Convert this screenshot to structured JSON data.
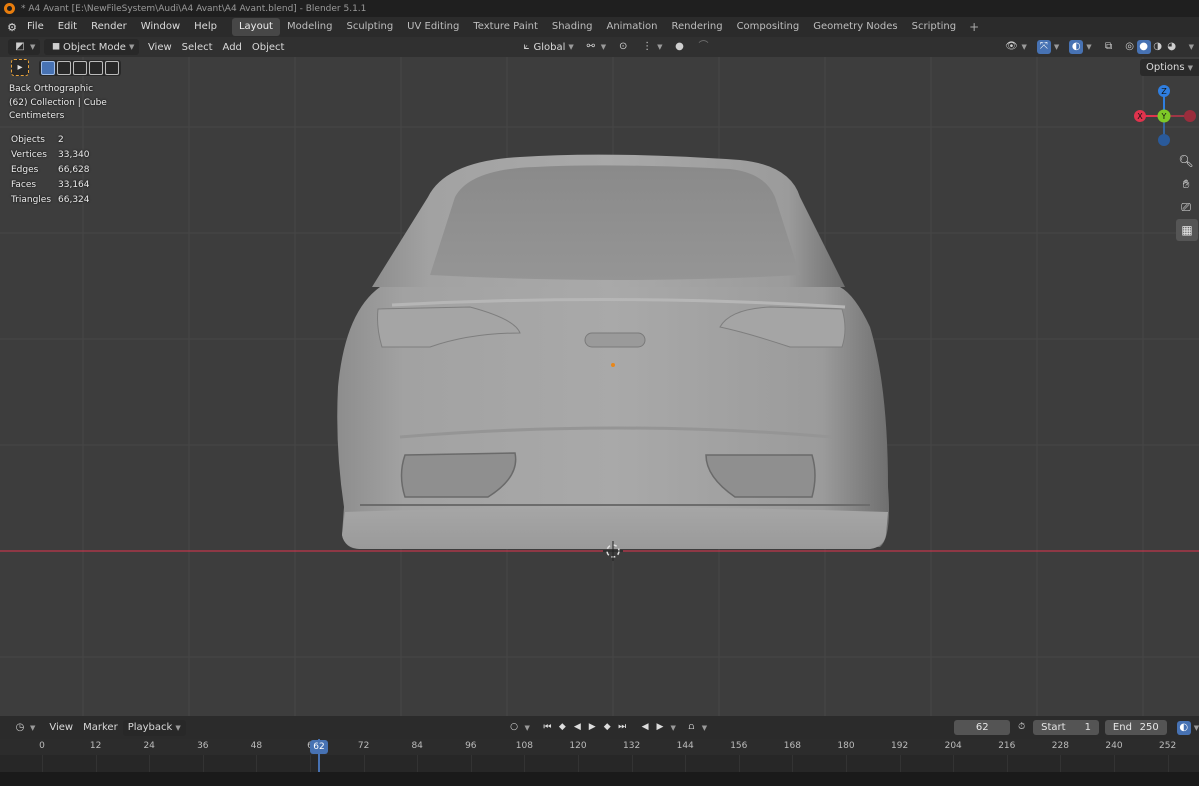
{
  "window": {
    "title": "* A4 Avant [E:\\NewFileSystem\\Audi\\A4 Avant\\A4 Avant.blend] - Blender 5.1.1"
  },
  "menu": [
    "File",
    "Edit",
    "Render",
    "Window",
    "Help"
  ],
  "workspaces": [
    "Layout",
    "Modeling",
    "Sculpting",
    "UV Editing",
    "Texture Paint",
    "Shading",
    "Animation",
    "Rendering",
    "Compositing",
    "Geometry Nodes",
    "Scripting"
  ],
  "active_workspace": "Layout",
  "header": {
    "mode": "Object Mode",
    "menus": [
      "View",
      "Select",
      "Add",
      "Object"
    ],
    "transform_orientation": "Global"
  },
  "viewport": {
    "view_name": "Back Orthographic",
    "collection": "(62) Collection | Cube",
    "units": "Centimeters",
    "stats": [
      {
        "label": "Objects",
        "value": "2"
      },
      {
        "label": "Vertices",
        "value": "33,340"
      },
      {
        "label": "Edges",
        "value": "66,628"
      },
      {
        "label": "Faces",
        "value": "33,164"
      },
      {
        "label": "Triangles",
        "value": "66,324"
      }
    ],
    "options_label": "Options",
    "gizmo": {
      "z": "Z",
      "x": "X",
      "y": "Y"
    },
    "colors": {
      "x_axis": "#e0334d",
      "y_axis": "#7ec927",
      "z_axis": "#2f7ee0",
      "background": "#3d3d3d"
    }
  },
  "timeline": {
    "menus": [
      "View",
      "Marker",
      "Playback"
    ],
    "current_frame": "62",
    "start_label": "Start",
    "start": "1",
    "end_label": "End",
    "end": "250",
    "ticks": [
      "0",
      "12",
      "24",
      "36",
      "48",
      "6",
      "72",
      "84",
      "96",
      "108",
      "120",
      "132",
      "144",
      "156",
      "168",
      "180",
      "192",
      "204",
      "216",
      "228",
      "240",
      "252"
    ]
  }
}
